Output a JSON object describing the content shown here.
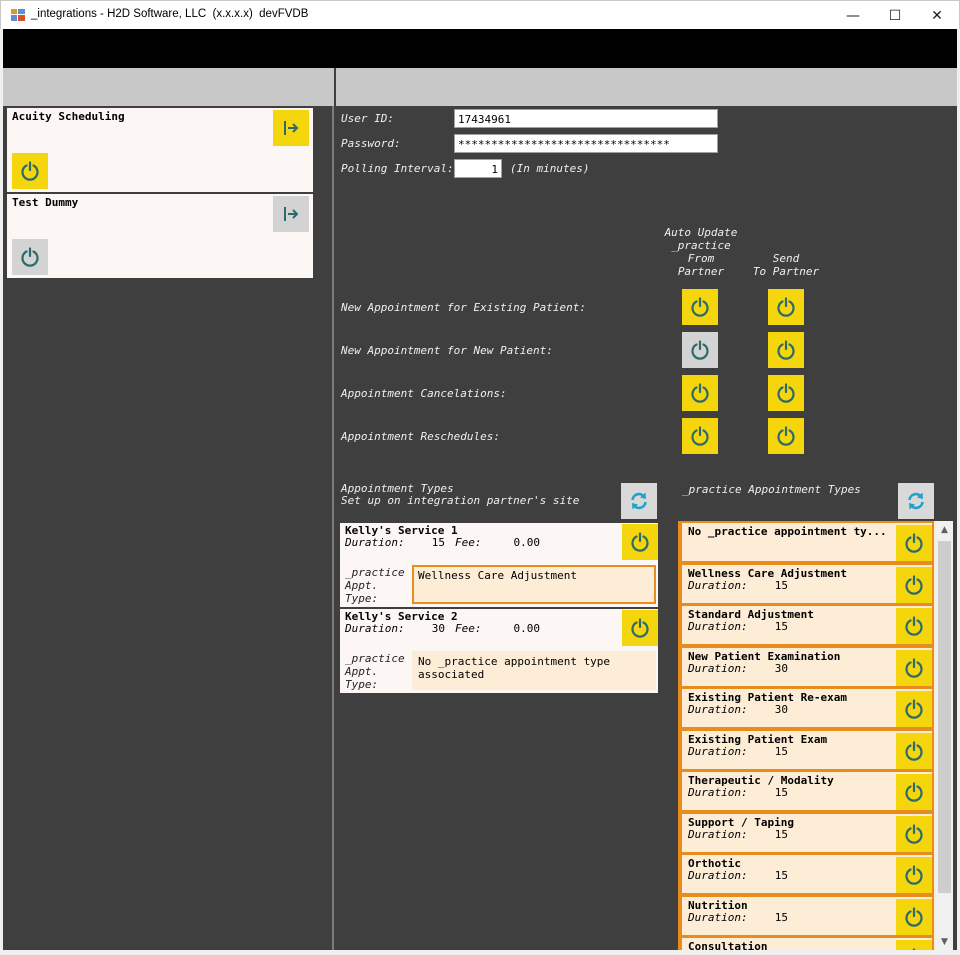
{
  "window": {
    "title": "_integrations - H2D Software, LLC  (x.x.x.x)  devFVDB",
    "minimize_glyph": "—",
    "maximize_glyph": "☐",
    "close_glyph": "✕"
  },
  "partners": [
    {
      "name": "Acuity Scheduling",
      "enabled": true,
      "active": true
    },
    {
      "name": "Test Dummy",
      "enabled": false,
      "active": false
    }
  ],
  "credentials": {
    "user_id_label": "User ID:",
    "user_id_value": "17434961",
    "password_label": "Password:",
    "password_value": "********************************",
    "polling_label": "Polling Interval:",
    "polling_value": "1",
    "polling_unit": "(In minutes)"
  },
  "sync_headers": {
    "auto_update": "Auto Update\n_practice\nFrom\nPartner",
    "send_to_partner": "Send\nTo Partner"
  },
  "sync_rows": [
    {
      "label": "New Appointment for Existing Patient:",
      "auto_update": true,
      "send": true
    },
    {
      "label": "New Appointment for New Patient:",
      "auto_update": false,
      "send": true
    },
    {
      "label": "Appointment Cancelations:",
      "auto_update": true,
      "send": true
    },
    {
      "label": "Appointment Reschedules:",
      "auto_update": true,
      "send": true
    }
  ],
  "appointment_types": {
    "title": "Appointment Types\nSet up on integration partner's site",
    "duration_label": "Duration:",
    "fee_label": "Fee:",
    "practice_type_label": "_practice\nAppt.\nType:",
    "items": [
      {
        "name": "Kelly's Service 1",
        "duration": "15",
        "fee": "0.00",
        "practice_type": "Wellness Care Adjustment",
        "active": true
      },
      {
        "name": "Kelly's Service 2",
        "duration": "30",
        "fee": "0.00",
        "practice_type": "No _practice appointment type associated",
        "active": false
      }
    ]
  },
  "practice_types": {
    "title": "_practice Appointment Types",
    "duration_label": "Duration:",
    "items": [
      {
        "name": "No _practice appointment ty...",
        "duration": ""
      },
      {
        "name": "Wellness Care Adjustment",
        "duration": "15"
      },
      {
        "name": "Standard Adjustment",
        "duration": "15"
      },
      {
        "name": "New Patient Examination",
        "duration": "30"
      },
      {
        "name": "Existing Patient Re-exam",
        "duration": "30"
      },
      {
        "name": "Existing Patient Exam",
        "duration": "15"
      },
      {
        "name": "Therapeutic / Modality",
        "duration": "15"
      },
      {
        "name": "Support / Taping",
        "duration": "15"
      },
      {
        "name": "Orthotic",
        "duration": "15"
      },
      {
        "name": "Nutrition",
        "duration": "15"
      },
      {
        "name": "Consultation",
        "duration": ""
      }
    ]
  },
  "colors": {
    "accent": "#f5d50b",
    "icon": "#2b6b6b",
    "panel": "#3f3f3f",
    "orange": "#e88c1e",
    "cream": "#fdecd6"
  },
  "icons": {
    "power": "power-icon",
    "partner_link": "exit-arrow-icon",
    "refresh": "refresh-icon"
  }
}
